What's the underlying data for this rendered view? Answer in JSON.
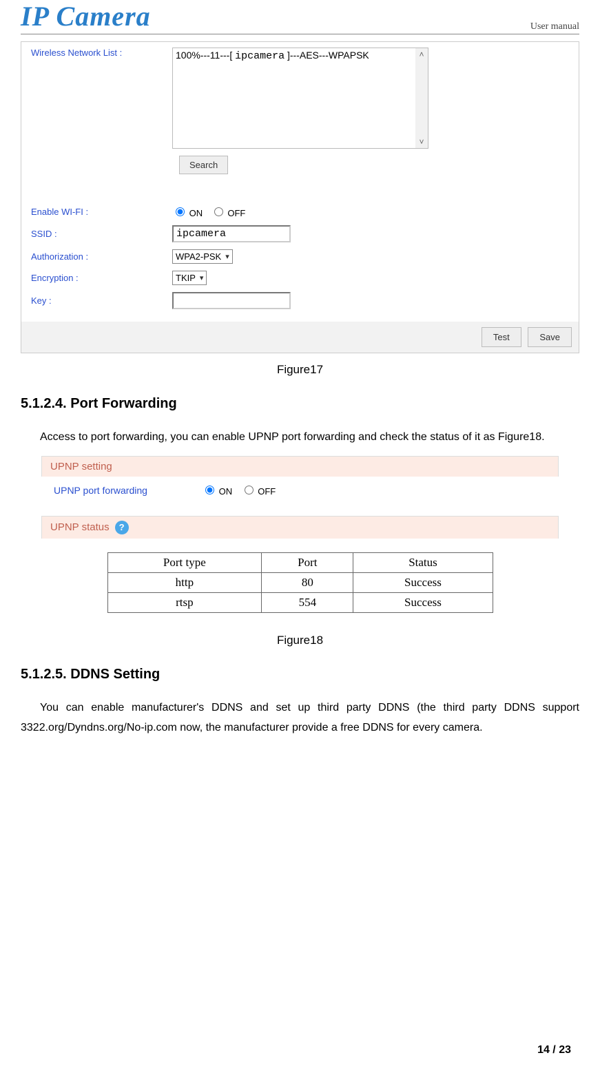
{
  "header": {
    "logo_text": "IP Camera",
    "doc_label": "User manual"
  },
  "fig17": {
    "wireless_list_label": "Wireless Network List :",
    "list_entry_prefix": "100%---11---[ ",
    "list_entry_mono": "ipcamera",
    "list_entry_suffix": " ]---AES---WPAPSK",
    "search_btn": "Search",
    "enable_label": "Enable WI-FI :",
    "on_label": "ON",
    "off_label": "OFF",
    "ssid_label": "SSID :",
    "ssid_value": "ipcamera",
    "auth_label": "Authorization :",
    "auth_value": "WPA2-PSK",
    "enc_label": "Encryption :",
    "enc_value": "TKIP",
    "key_label": "Key :",
    "key_value": "",
    "test_btn": "Test",
    "save_btn": "Save"
  },
  "caption17": "Figure17",
  "section1": {
    "heading": "5.1.2.4. Port Forwarding",
    "body": "Access to port forwarding, you can enable UPNP port forwarding and check the status of it as Figure18."
  },
  "fig18": {
    "panel1_title": "UPNP setting",
    "upnp_label": "UPNP port forwarding",
    "on_label": "ON",
    "off_label": "OFF",
    "panel2_title": "UPNP status",
    "table": {
      "headers": [
        "Port type",
        "Port",
        "Status"
      ],
      "rows": [
        [
          "http",
          "80",
          "Success"
        ],
        [
          "rtsp",
          "554",
          "Success"
        ]
      ]
    }
  },
  "caption18": "Figure18",
  "section2": {
    "heading": "5.1.2.5. DDNS Setting",
    "body": "You can enable manufacturer's DDNS and set up third party DDNS (the third party DDNS support 3322.org/Dyndns.org/No-ip.com now, the manufacturer provide a free DDNS for every camera."
  },
  "page_number": "14 / 23"
}
